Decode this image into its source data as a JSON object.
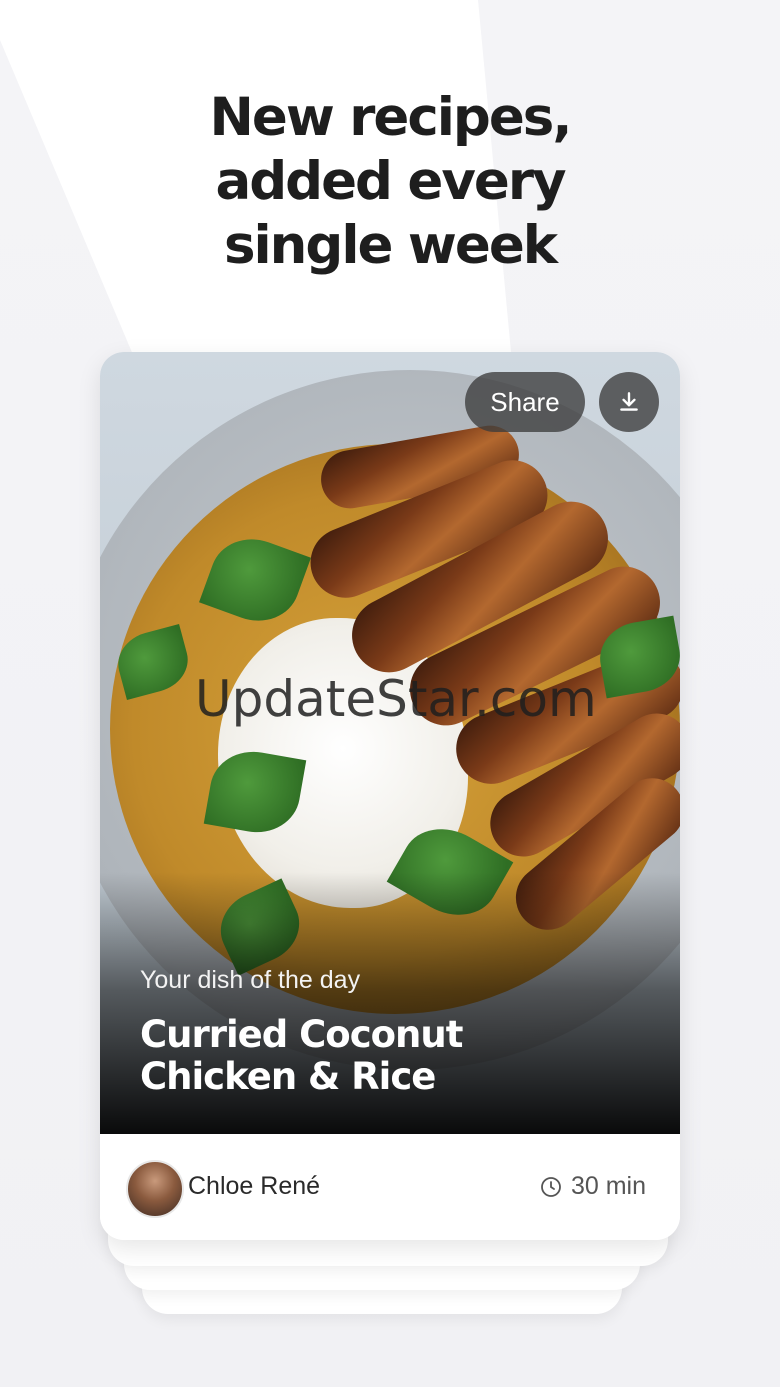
{
  "headline": {
    "line1": "New recipes,",
    "line2": "added every",
    "line3": "single week"
  },
  "card": {
    "share_label": "Share",
    "download_icon": "download-icon",
    "watermark": "UpdateStar.com",
    "kicker": "Your dish of the day",
    "title_line1": "Curried Coconut",
    "title_line2": "Chicken & Rice",
    "author_name": "Chloe René",
    "clock_icon": "clock-icon",
    "time": "30 min"
  }
}
